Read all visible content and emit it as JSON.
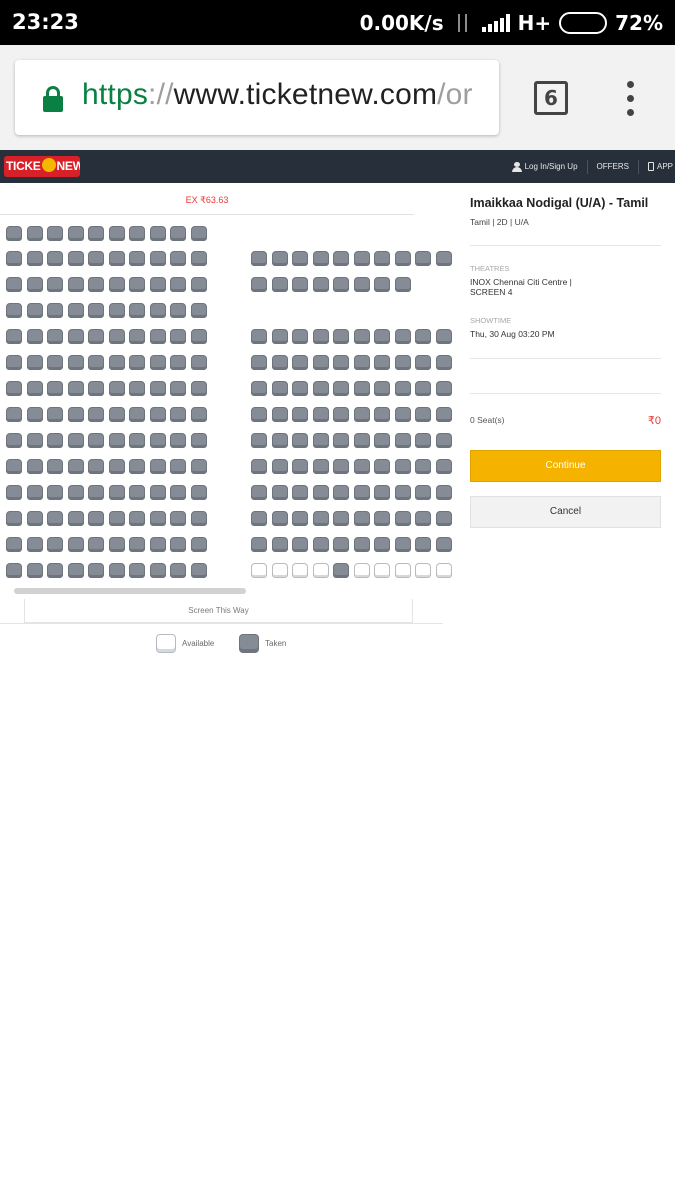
{
  "status_bar": {
    "time": "23:23",
    "net_speed": "0.00K/s",
    "network_type": "H+",
    "battery_percent": "72%",
    "battery_level": 0.72
  },
  "browser": {
    "url": {
      "scheme": "https",
      "sep": "://",
      "host": "www.ticketnew.com",
      "path": "/or"
    },
    "tab_count": "6",
    "icons": [
      "lock-icon",
      "tabs-icon",
      "overflow-menu-icon"
    ]
  },
  "site_header": {
    "logo_text_left": "TICKE",
    "logo_text_right": "NEW",
    "links": [
      "Log In/Sign Up",
      "OFFERS",
      "APP"
    ]
  },
  "seat_layout": {
    "price_tab": "EX ₹63.63",
    "rows": [
      {
        "left": "TTTTTTTTTT",
        "right": ""
      },
      {
        "left": "TTTTTTTTTT",
        "right": "TTTTTTTTTT"
      },
      {
        "left": "TTTTTTTTTT",
        "right": "TTTTTTTT"
      },
      {
        "left": "TTTTTTTTTT",
        "right": ""
      },
      {
        "left": "TTTTTTTTTT",
        "right": "TTTTTTTTTT"
      },
      {
        "left": "TTTTTTTTTT",
        "right": "TTTTTTTTTT"
      },
      {
        "left": "TTTTTTTTTT",
        "right": "TTTTTTTTTT"
      },
      {
        "left": "TTTTTTTTTT",
        "right": "TTTTTTTTTT"
      },
      {
        "left": "TTTTTTTTTT",
        "right": "TTTTTTTTTT"
      },
      {
        "left": "TTTTTTTTTT",
        "right": "TTTTTTTTTT"
      },
      {
        "left": "TTTTTTTTTT",
        "right": "TTTTTTTTTT"
      },
      {
        "left": "TTTTTTTTTT",
        "right": "TTTTTTTTTT"
      },
      {
        "left": "TTTTTTTTTT",
        "right": "TTTTTTTTTT"
      },
      {
        "left": "TTTTTTTTTT",
        "right": "AAAATAAAAA"
      }
    ],
    "screen_label": "Screen This Way",
    "legend": {
      "available": "Available",
      "taken": "Taken"
    }
  },
  "booking_panel": {
    "movie_title": "Imaikkaa Nodigal (U/A) - Tamil",
    "movie_meta": "Tamil | 2D | U/A",
    "theatres_label": "THEATRES",
    "theatre_line1": "INOX Chennai Citi Centre |",
    "theatre_line2": "SCREEN 4",
    "showtime_label": "SHOWTIME",
    "showtime": "Thu, 30 Aug 03:20 PM",
    "seats_selected": "0 Seat(s)",
    "total": "₹0",
    "continue_label": "Continue",
    "cancel_label": "Cancel"
  }
}
